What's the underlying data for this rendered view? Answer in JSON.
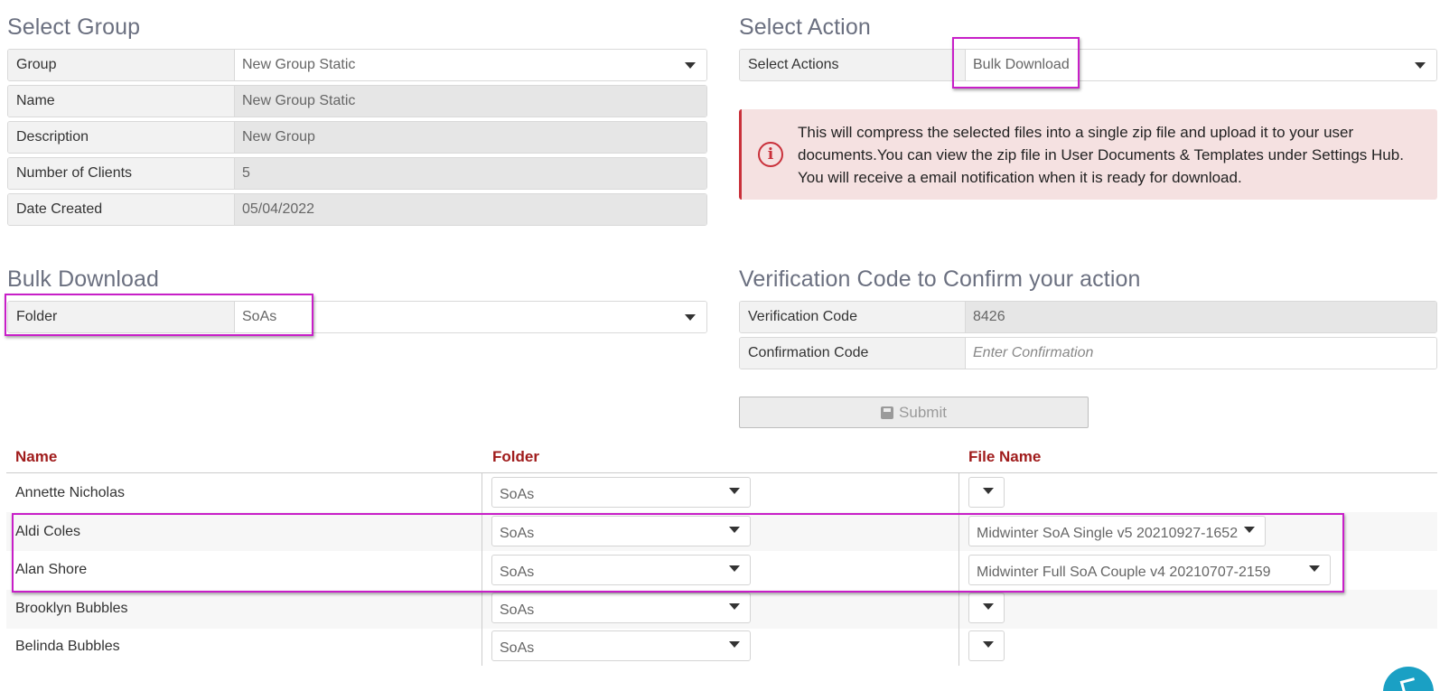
{
  "select_group": {
    "title": "Select Group",
    "fields": [
      {
        "label": "Group",
        "value": "New Group Static"
      },
      {
        "label": "Name",
        "value": "New Group Static"
      },
      {
        "label": "Description",
        "value": "New Group"
      },
      {
        "label": "Number of Clients",
        "value": "5"
      },
      {
        "label": "Date Created",
        "value": "05/04/2022"
      }
    ]
  },
  "select_action": {
    "title": "Select Action",
    "label": "Select Actions",
    "value": "Bulk Download",
    "alert": "This will compress the selected files into a single zip file and upload it to your user documents.You can view the zip file in User Documents & Templates under Settings Hub. You will receive a email notification when it is ready for download."
  },
  "bulk_download": {
    "title": "Bulk Download",
    "folder_label": "Folder",
    "folder_value": "SoAs"
  },
  "verification": {
    "title": "Verification Code to Confirm your action",
    "code_label": "Verification Code",
    "code_value": "8426",
    "confirm_label": "Confirmation Code",
    "confirm_placeholder": "Enter Confirmation",
    "submit_label": "Submit"
  },
  "table": {
    "headers": {
      "name": "Name",
      "folder": "Folder",
      "file": "File Name"
    },
    "rows": [
      {
        "name": "Annette Nicholas",
        "folder": "SoAs",
        "file": ""
      },
      {
        "name": "Aldi Coles",
        "folder": "SoAs",
        "file": "Midwinter SoA Single v5 20210927-1652"
      },
      {
        "name": "Alan Shore",
        "folder": "SoAs",
        "file": "Midwinter Full SoA Couple v4 20210707-2159"
      },
      {
        "name": "Brooklyn Bubbles",
        "folder": "SoAs",
        "file": ""
      },
      {
        "name": "Belinda Bubbles",
        "folder": "SoAs",
        "file": ""
      }
    ]
  },
  "colors": {
    "highlight": "#c81fc8",
    "header_text": "#a01c1c",
    "alert_bg": "#f5e1e1",
    "alert_border": "#c9303a",
    "fab": "#1aa0c4"
  },
  "icons": {
    "alert": "info-circle-icon",
    "submit": "floppy-disk-icon",
    "fab": "share-icon"
  }
}
